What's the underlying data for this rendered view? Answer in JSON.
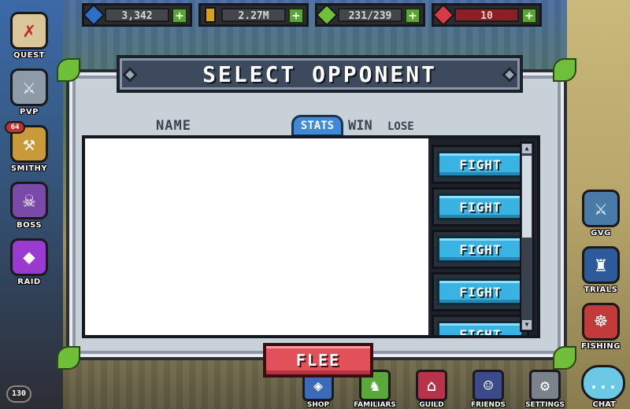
{
  "resources": {
    "gems": {
      "value": "3,342",
      "color": "#2f6ec8",
      "icon": "gem-icon"
    },
    "gold": {
      "value": "2.27M",
      "color": "#d4a120",
      "icon": "gold-bar-icon"
    },
    "energy": {
      "value": "231/239",
      "color": "#6fbf3a",
      "icon": "energy-scroll-icon"
    },
    "hearts": {
      "value": "10",
      "color": "#d83a48",
      "icon": "heart-gem-icon"
    },
    "plus": "+"
  },
  "left_nav": [
    {
      "label": "QUEST",
      "icon": "quest-map-icon",
      "glyph": "✗"
    },
    {
      "label": "PVP",
      "icon": "crossed-swords-icon",
      "glyph": "⚔"
    },
    {
      "label": "SMITHY",
      "icon": "anvil-icon",
      "glyph": "⚒",
      "badge": "64"
    },
    {
      "label": "BOSS",
      "icon": "skull-icon",
      "glyph": "☠"
    },
    {
      "label": "RAID",
      "icon": "raid-crystal-icon",
      "glyph": "◆"
    }
  ],
  "right_nav": [
    {
      "label": "GVG",
      "icon": "gvg-shield-icon",
      "glyph": "⚔"
    },
    {
      "label": "TRIALS",
      "icon": "trials-tower-icon",
      "glyph": "♜"
    },
    {
      "label": "FISHING",
      "icon": "fishing-icon",
      "glyph": "☸"
    }
  ],
  "bottom_nav": [
    {
      "label": "SHOP",
      "icon": "shop-icon",
      "glyph": "◈"
    },
    {
      "label": "FAMILIARS",
      "icon": "familiars-icon",
      "glyph": "♞"
    },
    {
      "label": "GUILD",
      "icon": "guild-banner-icon",
      "glyph": "⌂"
    },
    {
      "label": "FRIENDS",
      "icon": "friends-icon",
      "glyph": "☺"
    },
    {
      "label": "SETTINGS",
      "icon": "gear-icon",
      "glyph": "⚙"
    }
  ],
  "player": {
    "level": "130"
  },
  "chat": {
    "label": "CHAT",
    "glyph": "..."
  },
  "modal": {
    "title": "SELECT OPPONENT",
    "columns": {
      "name": "NAME",
      "stats": "STATS",
      "win": "WIN",
      "lose": "LOSE"
    },
    "fight_label": "FIGHT",
    "fight_rows": 5,
    "flee_label": "FLEE"
  }
}
